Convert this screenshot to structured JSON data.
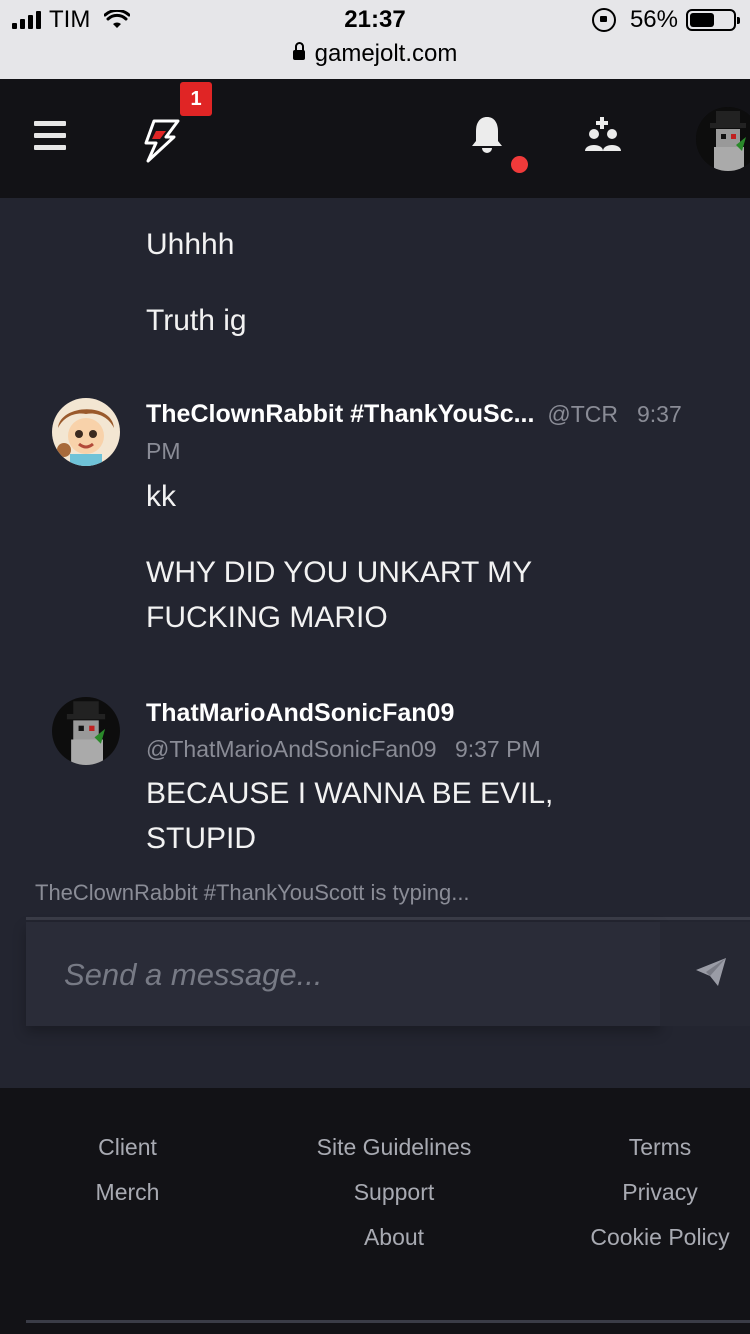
{
  "status_bar": {
    "carrier": "TIM",
    "time": "21:37",
    "url": "gamejolt.com",
    "battery": "56%",
    "battery_level": 0.56
  },
  "nav": {
    "notification_badge": "1",
    "icons": [
      "menu-icon",
      "gamejolt-logo",
      "bell-icon",
      "friends-icon",
      "avatar"
    ]
  },
  "messages": [
    {
      "text": "Uhhhh"
    },
    {
      "text": "Truth ig"
    },
    {
      "author": "TheClownRabbit #ThankYouSc...",
      "handle": "@TCR",
      "time": "9:37",
      "time_suffix": "PM",
      "lines": [
        "kk",
        "WHY DID YOU UNKART MY",
        "FUCKING MARIO"
      ]
    },
    {
      "author": "ThatMarioAndSonicFan09",
      "handle": "@ThatMarioAndSonicFan09",
      "time": "9:37 PM",
      "lines": [
        "BECAUSE I WANNA BE EVIL,",
        "STUPID"
      ]
    }
  ],
  "typing_indicator": "TheClownRabbit #ThankYouScott is typing...",
  "composer": {
    "placeholder": "Send a message..."
  },
  "footer": {
    "col1": [
      "Client",
      "Merch"
    ],
    "col2": [
      "Site Guidelines",
      "Support",
      "About"
    ],
    "col3": [
      "Terms",
      "Privacy",
      "Cookie Policy"
    ]
  },
  "colors": {
    "accent_red": "#e02525",
    "background": "#232530",
    "header": "#121216"
  }
}
